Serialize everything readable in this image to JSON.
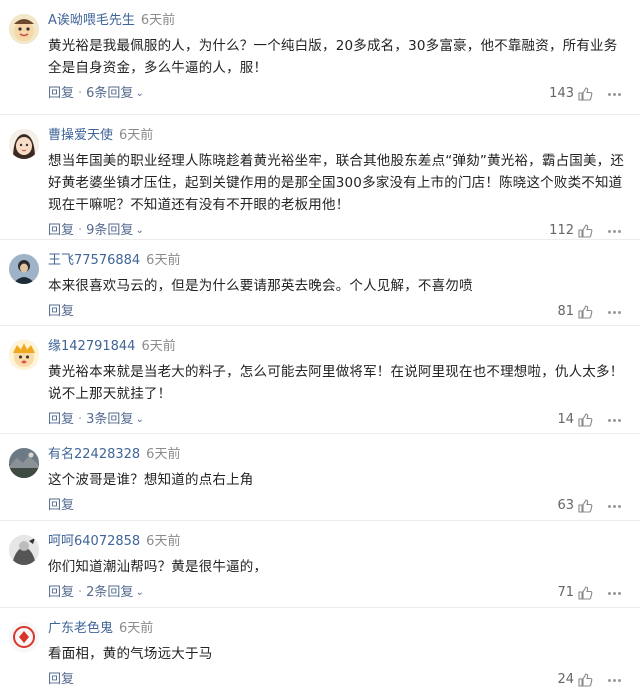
{
  "labels": {
    "reply": "回复",
    "separator": "·"
  },
  "comments": [
    {
      "username": "A诶呦喂毛先生",
      "time": "6天前",
      "text": "黄光裕是我最佩服的人，为什么？一个纯白版，20多成名，30多富豪，他不靠融资，所有业务全是自身资金，多么牛逼的人，服！",
      "replies": "6条回复",
      "likes": "143",
      "avatar": "cartoon-face"
    },
    {
      "username": "曹操爱天使",
      "time": "6天前",
      "text": "想当年国美的职业经理人陈晓趁着黄光裕坐牢，联合其他股东差点“弹劾”黄光裕，霸占国美，还好黄老婆坐镇才压住，起到关键作用的是那全国300多家没有上市的门店！陈晓这个败类不知道现在干嘛呢？不知道还有没有不开眼的老板用他！",
      "replies": "9条回复",
      "likes": "112",
      "avatar": "cartoon-girl"
    },
    {
      "username": "王飞77576884",
      "time": "6天前",
      "text": "本来很喜欢马云的，但是为什么要请那英去晚会。个人见解，不喜勿喷",
      "replies": "",
      "likes": "81",
      "avatar": "photo-person"
    },
    {
      "username": "缘142791844",
      "time": "6天前",
      "text": "黄光裕本来就是当老大的料子，怎么可能去阿里做将军！在说阿里现在也不理想啦，仇人太多！说不上那天就挂了！",
      "replies": "3条回复",
      "likes": "14",
      "avatar": "cartoon-boy"
    },
    {
      "username": "有名22428328",
      "time": "6天前",
      "text": "这个波哥是谁？想知道的点右上角",
      "replies": "",
      "likes": "63",
      "avatar": "photo-landscape"
    },
    {
      "username": "呵呵64072858",
      "time": "6天前",
      "text": "你们知道潮汕帮吗？黄是很牛逼的，",
      "replies": "2条回复",
      "likes": "71",
      "avatar": "photo-bw"
    },
    {
      "username": "广东老色鬼",
      "time": "6天前",
      "text": "看面相，黄的气场远大于马",
      "replies": "",
      "likes": "24",
      "avatar": "logo-red"
    }
  ]
}
